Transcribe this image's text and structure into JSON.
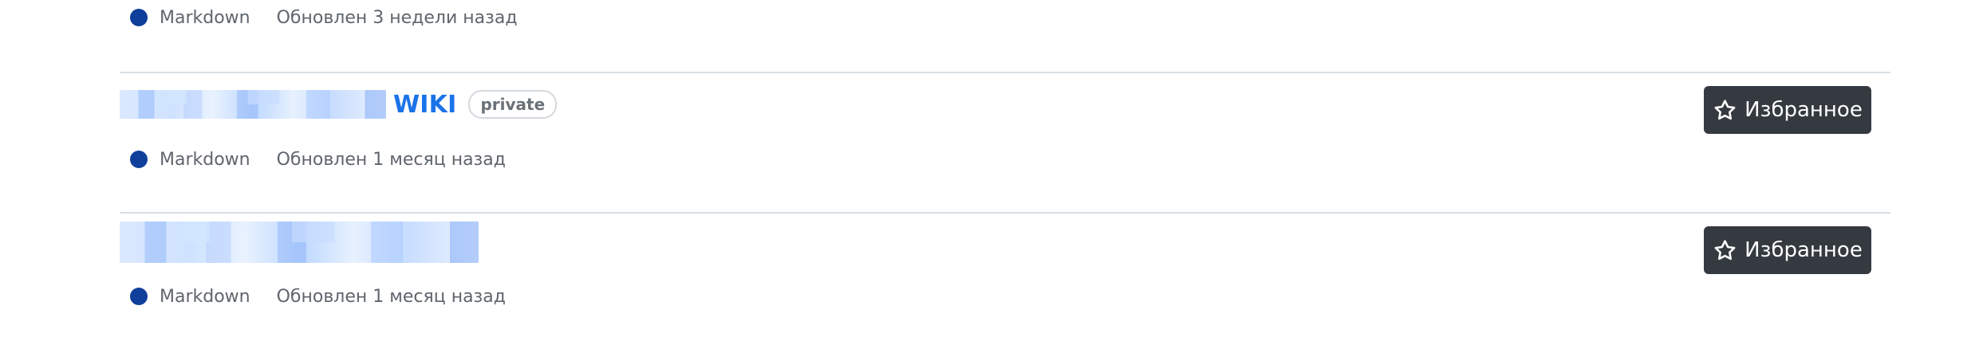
{
  "items": [
    {
      "title_suffix": "",
      "visibility": "",
      "language": "Markdown",
      "updated": "Обновлен 3 недели назад",
      "star_label": ""
    },
    {
      "title_suffix": "WIKI",
      "visibility": "private",
      "language": "Markdown",
      "updated": "Обновлен 1 месяц назад",
      "star_label": "Избранное"
    },
    {
      "title_suffix": "",
      "visibility": "",
      "language": "Markdown",
      "updated": "Обновлен 1 месяц назад",
      "star_label": "Избранное"
    }
  ],
  "icons": {
    "star": "star-outline-icon",
    "language_dot_color": "#0f3f9b"
  },
  "colors": {
    "link": "#1a73e8",
    "button_bg": "#343a40",
    "divider": "#d8dee4"
  }
}
